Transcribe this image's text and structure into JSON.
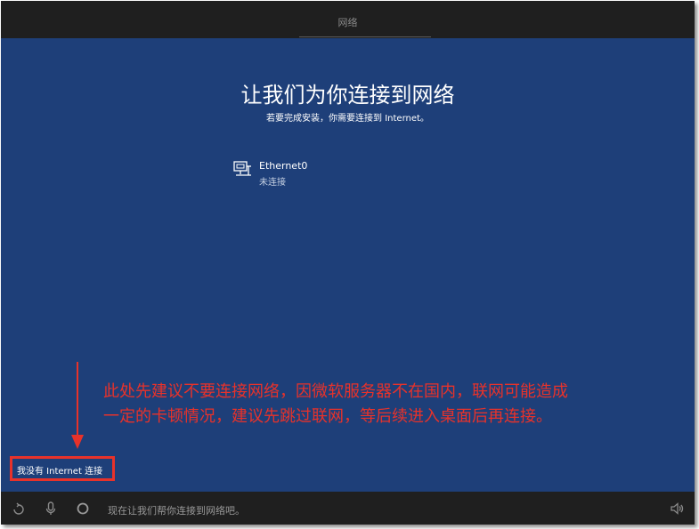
{
  "header": {
    "title": "网络"
  },
  "main": {
    "heading": "让我们为你连接到网络",
    "subheading": "若要完成安装，你需要连接到 Internet。",
    "network": {
      "name": "Ethernet0",
      "status": "未连接",
      "icon": "ethernet-icon"
    }
  },
  "annotation": {
    "line1": "此处先建议不要连接网络，因微软服务器不在国内，联网可能造成",
    "line2": "一定的卡顿情况，建议先跳过联网，等后续进入桌面后再连接。",
    "color": "#e8322a"
  },
  "skip_link": {
    "label": "我没有 Internet 连接"
  },
  "taskbar": {
    "status_text": "现在让我们帮你连接到网络吧。",
    "icons": [
      "accessibility-icon",
      "microphone-icon",
      "cortana-icon",
      "volume-icon"
    ]
  },
  "colors": {
    "background": "#1e3f79",
    "bars": "#1f1f1f",
    "highlight": "#e8322a"
  }
}
